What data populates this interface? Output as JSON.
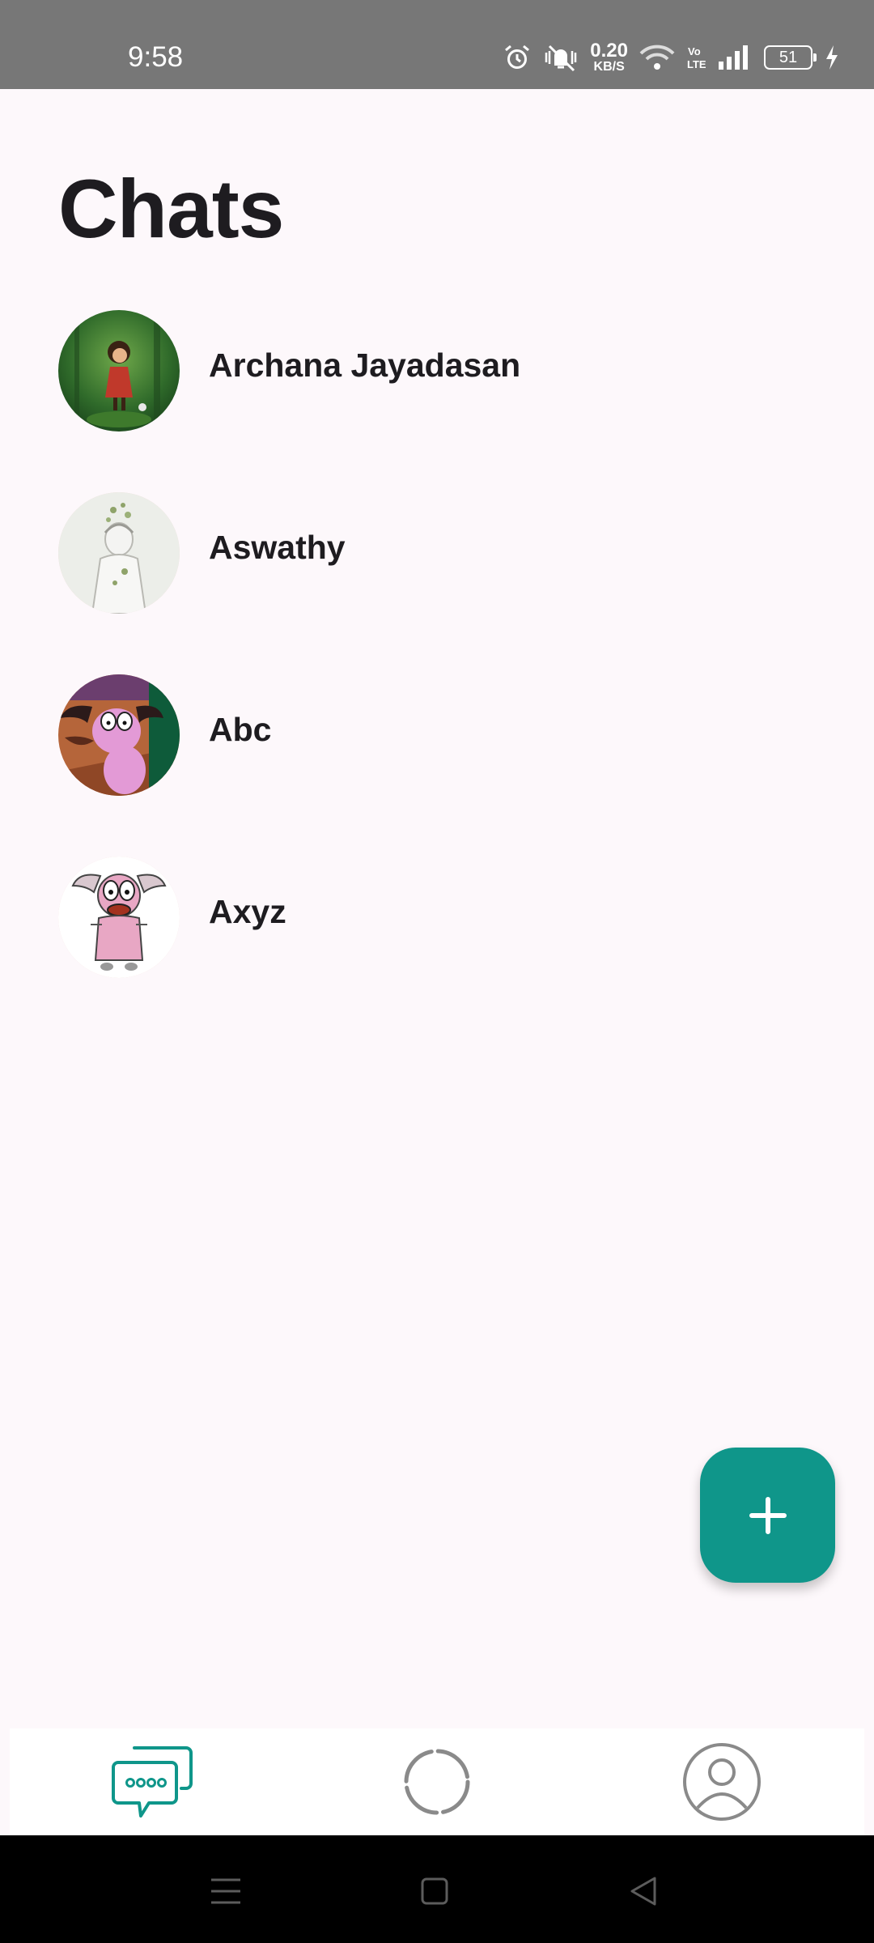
{
  "status_bar": {
    "time": "9:58",
    "speed_value": "0.20",
    "speed_unit": "KB/S",
    "volte": "Vo LTE",
    "battery": "51",
    "icons": [
      "alarm-icon",
      "mute-vibrate-icon",
      "wifi-icon",
      "signal-icon",
      "battery-icon",
      "charging-icon"
    ]
  },
  "header": {
    "title": "Chats"
  },
  "chats": [
    {
      "name": "Archana Jayadasan",
      "avatar": "forest-girl-avatar"
    },
    {
      "name": "Aswathy",
      "avatar": "sketch-figure-avatar"
    },
    {
      "name": "Abc",
      "avatar": "courage-dog-avatar"
    },
    {
      "name": "Axyz",
      "avatar": "courage-dog-cartoon-avatar"
    }
  ],
  "fab": {
    "icon": "plus-icon"
  },
  "bottom_nav": {
    "tabs": [
      {
        "name": "chats",
        "icon": "chat-bubbles-icon",
        "active": true
      },
      {
        "name": "status",
        "icon": "status-ring-icon",
        "active": false
      },
      {
        "name": "profile",
        "icon": "profile-icon",
        "active": false
      }
    ]
  },
  "colors": {
    "accent": "#0f968a",
    "background": "#fdf8fb",
    "status_bar": "#777777"
  }
}
